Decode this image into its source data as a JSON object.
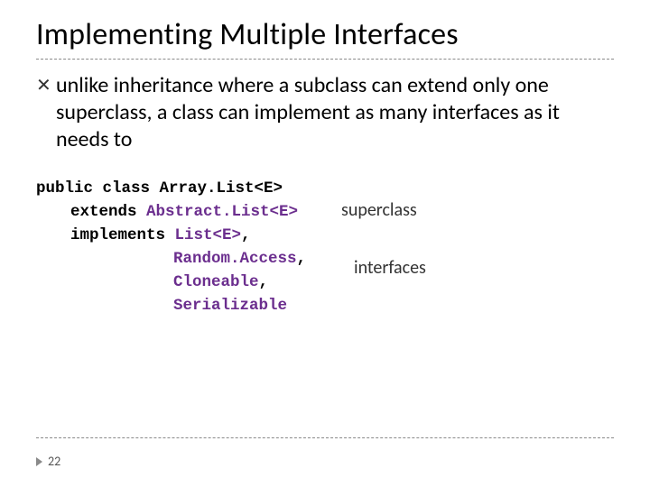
{
  "title": "Implementing Multiple Interfaces",
  "bullet": {
    "marker": "✕",
    "text": "unlike inheritance where a subclass can extend only one superclass, a class can implement as many interfaces as it needs to"
  },
  "code": {
    "l1a": "public class ",
    "l1b": "Array.List<E>",
    "l2a": "extends ",
    "l2b": "Abstract.List<E>",
    "l3a": "implements ",
    "l3b": "List<E>",
    "l3c": ",",
    "l4": "Random.Access",
    "l4c": ",",
    "l5": "Cloneable",
    "l5c": ",",
    "l6": "Serializable"
  },
  "annot": {
    "super": "superclass",
    "iface": "interfaces"
  },
  "page": "22"
}
